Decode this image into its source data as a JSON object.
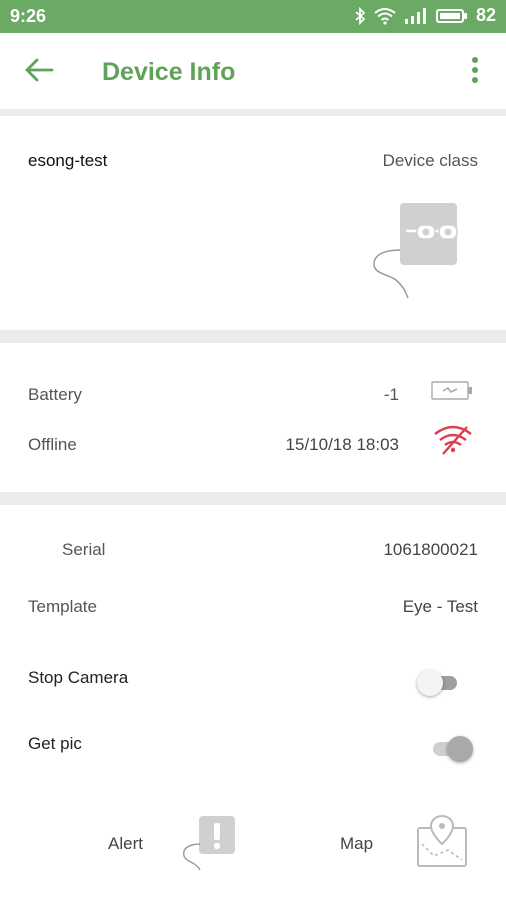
{
  "status_bar": {
    "time": "9:26",
    "battery": "82"
  },
  "header": {
    "title": "Device Info"
  },
  "device": {
    "name": "esong-test",
    "class_label": "Device class"
  },
  "status": {
    "battery_label": "Battery",
    "battery_value": "-1",
    "connection_label": "Offline",
    "connection_time": "15/10/18 18:03"
  },
  "details": {
    "serial_label": "Serial",
    "serial_value": "1061800021",
    "template_label": "Template",
    "template_value": "Eye - Test"
  },
  "settings": {
    "stop_camera_label": "Stop Camera",
    "stop_camera_on": false,
    "get_pic_label": "Get pic",
    "get_pic_on": true
  },
  "actions": {
    "alert_label": "Alert",
    "map_label": "Map"
  },
  "colors": {
    "accent": "#5fa35a",
    "status_bar": "#6aaa64",
    "offline_red": "#e03c4f"
  }
}
